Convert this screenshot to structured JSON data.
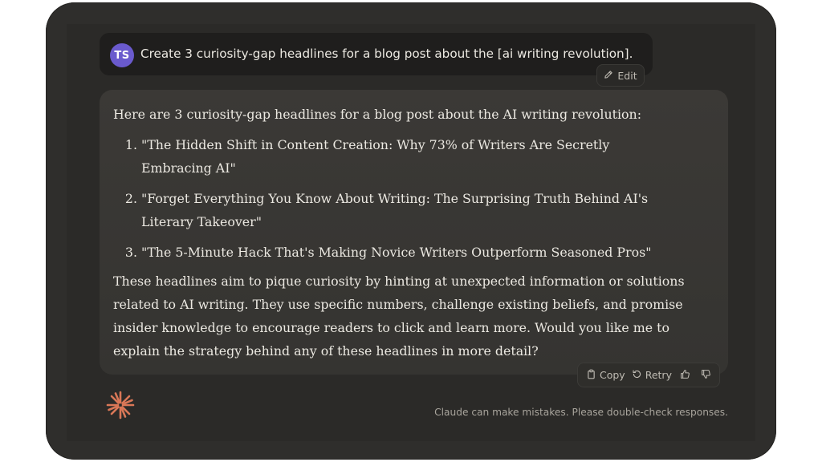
{
  "user_message": {
    "avatar_initials": "TS",
    "text": "Create 3 curiosity-gap headlines for a blog post about the [ai writing revolution].",
    "edit_label": "Edit"
  },
  "assistant_message": {
    "intro": "Here are 3 curiosity-gap headlines for a blog post about the AI writing revolution:",
    "headlines": [
      {
        "number": "1.",
        "text": "\"The Hidden Shift in Content Creation: Why 73% of Writers Are Secretly Embracing AI\""
      },
      {
        "number": "2.",
        "text": "\"Forget Everything You Know About Writing: The Surprising Truth Behind AI's Literary Takeover\""
      },
      {
        "number": "3.",
        "text": "\"The 5-Minute Hack That's Making Novice Writers Outperform Seasoned Pros\""
      }
    ],
    "outro": "These headlines aim to pique curiosity by hinting at unexpected information or solutions related to AI writing. They use specific numbers, challenge existing beliefs, and promise insider knowledge to encourage readers to click and learn more. Would you like me to explain the strategy behind any of these headlines in more detail?"
  },
  "actions": {
    "copy_label": "Copy",
    "retry_label": "Retry",
    "icons": [
      "clipboard-icon",
      "retry-icon",
      "thumbs-up-icon",
      "thumbs-down-icon"
    ]
  },
  "footer": {
    "disclaimer": "Claude can make mistakes. Please double-check responses.",
    "logo_icon": "claude-logo"
  },
  "colors": {
    "frame_bg": "#2f2e2c",
    "user_bubble_bg": "#1f1e1d",
    "assistant_bubble_bg": "#3a3835",
    "avatar_bg": "#6a5acd",
    "logo_accent": "#d97757",
    "text_primary": "#ece9e2",
    "text_muted": "#a8a49c"
  }
}
